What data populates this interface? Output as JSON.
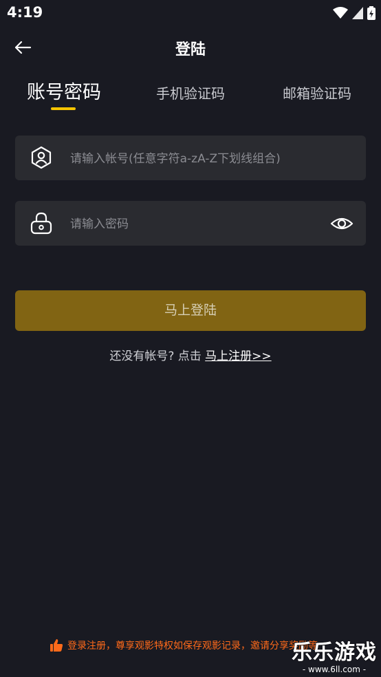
{
  "status_bar": {
    "time": "4:19"
  },
  "header": {
    "title": "登陆"
  },
  "tabs": [
    {
      "label": "账号密码",
      "active": true
    },
    {
      "label": "手机验证码",
      "active": false
    },
    {
      "label": "邮箱验证码",
      "active": false
    }
  ],
  "form": {
    "account_placeholder": "请输入帐号(任意字符a-zA-Z下划线组合)",
    "password_placeholder": "请输入密码",
    "login_label": "马上登陆"
  },
  "register": {
    "prompt": "还没有帐号? 点击 ",
    "link": "马上注册>>"
  },
  "promo": {
    "text": "登录注册，尊享观影特权如保存观影记录，邀请分享奖励等"
  },
  "watermark": {
    "title": "乐乐游戏",
    "url": "- www.6ll.com -"
  },
  "colors": {
    "background": "#191a22",
    "field": "#2a2b30",
    "accent": "#f5c400",
    "button": "#816413",
    "promo": "#ff6a1a"
  }
}
